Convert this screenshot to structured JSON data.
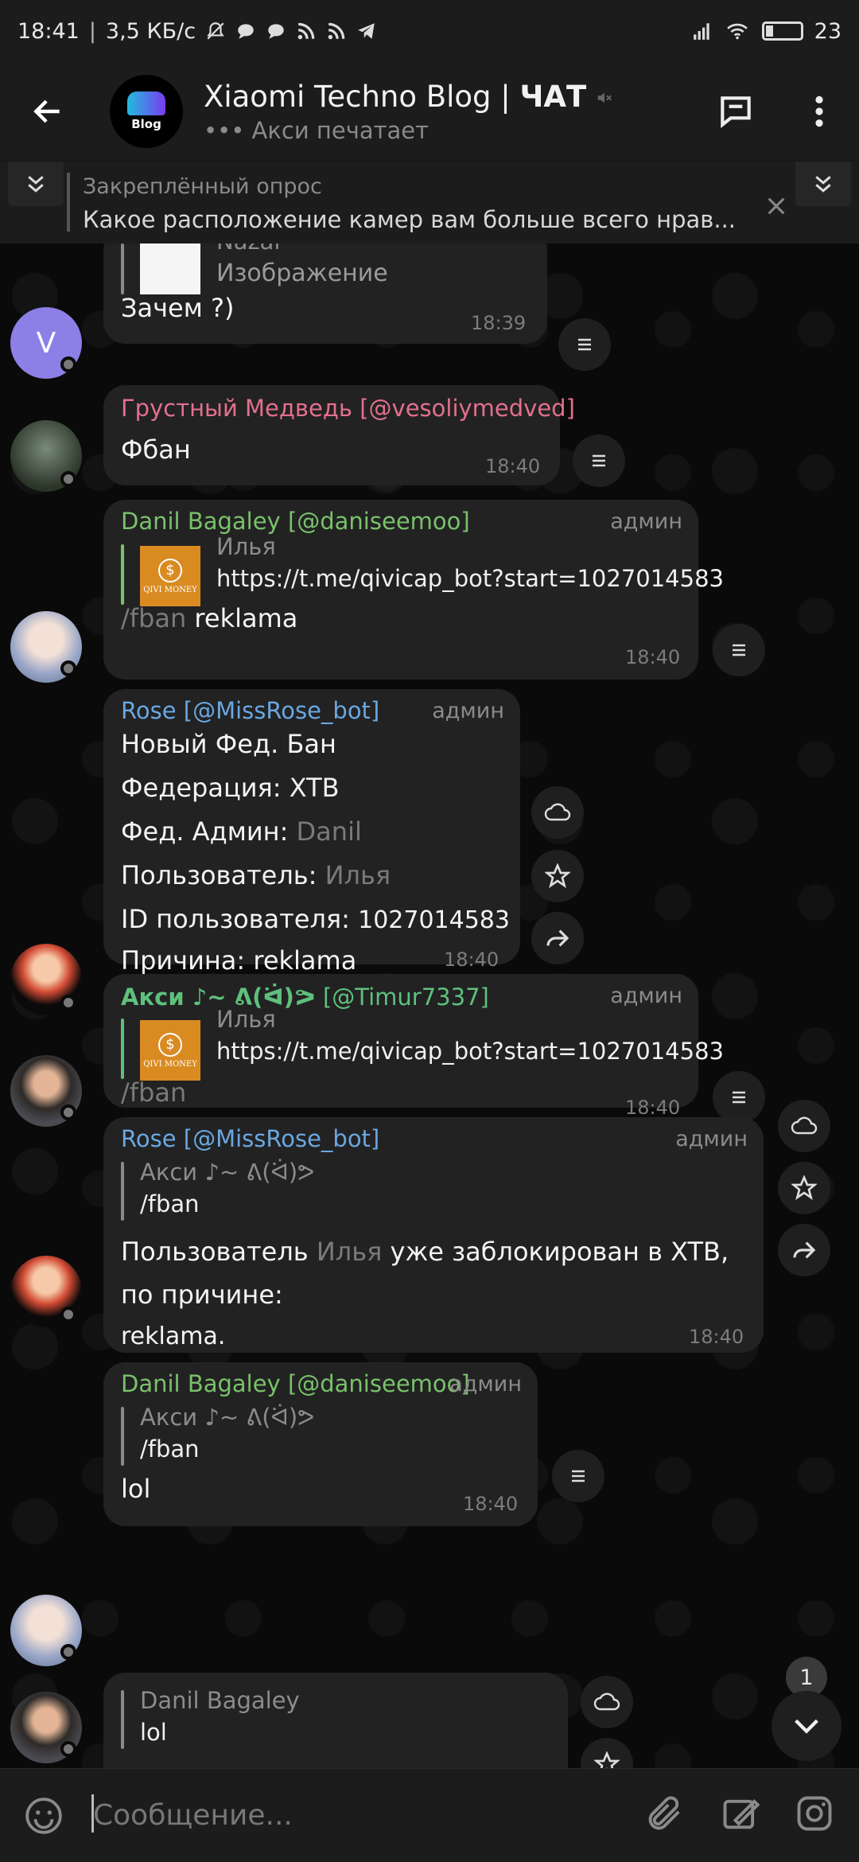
{
  "status_bar": {
    "time": "18:41",
    "speed": "3,5 КБ/с",
    "battery": "23"
  },
  "header": {
    "title": "Xiaomi Techno Blog | ",
    "title_bold": "ЧАТ",
    "subtitle": "••• Акси печатает",
    "avatar_label": "Blog"
  },
  "pinned": {
    "title": "Закреплённый опрос",
    "text": "Какое расположение камер вам больше всего нрав..."
  },
  "messages": [
    {
      "reply_name": "Nazar",
      "reply_text": "Изображение",
      "text": "Зачем ?)",
      "time": "18:39",
      "avatar_letter": "V"
    },
    {
      "name": "Грустный Медведь",
      "handle": "[@vesoliymedved]",
      "text": "Фбан",
      "time": "18:40"
    },
    {
      "name": "Danil Bagaley [@daniseemoo]",
      "admin": "админ",
      "reply_name": "Илья",
      "reply_text": "https://t.me/qivicap_bot?start=1027014583",
      "cmd": "/fban",
      "text": "reklama",
      "time": "18:40",
      "thumb_label": "QIVI MONEY"
    },
    {
      "name": "Rose [@MissRose_bot]",
      "admin": "админ",
      "lines": [
        {
          "key": "Новый Фед. Бан",
          "value": ""
        },
        {
          "key": "Федерация:",
          "value": "XTB"
        },
        {
          "key": "Фед. Админ:",
          "value": "Danil"
        },
        {
          "key": "Пользователь:",
          "value": "Илья"
        },
        {
          "key": "ID пользователя:",
          "value": "1027014583"
        },
        {
          "key": "Причина:",
          "value": "reklama"
        }
      ],
      "time": "18:40"
    },
    {
      "name": "Акси ♪~ ᕕ(ᐛ)ᕗ",
      "handle": "[@Timur7337]",
      "admin": "админ",
      "reply_name": "Илья",
      "reply_text": "https://t.me/qivicap_bot?start=1027014583",
      "cmd": "/fban",
      "time": "18:40",
      "thumb_label": "QIVI MONEY"
    },
    {
      "name": "Rose [@MissRose_bot]",
      "admin": "админ",
      "reply_name": "Акси ♪~ ᕕ(ᐛ)ᕗ",
      "reply_text": "/fban",
      "text_1a": "Пользователь ",
      "text_1b": "Илья",
      "text_1c": " уже заблокирован в XTB,",
      "text_2": "по причине:",
      "text_3": "reklama.",
      "time": "18:40"
    },
    {
      "name": "Danil Bagaley [@daniseemoo]",
      "admin": "админ",
      "reply_name": "Акси ♪~ ᕕ(ᐛ)ᕗ",
      "reply_text": "/fban",
      "text": "lol",
      "time": "18:40"
    },
    {
      "reply_name": "Danil Bagaley",
      "reply_text": "lol"
    }
  ],
  "input": {
    "placeholder": "Сообщение..."
  },
  "fab": {
    "badge": "1"
  },
  "colors": {
    "name_pink": "#e3708e",
    "name_green": "#79c26a",
    "name_blue": "#6aa7e0",
    "name_teal": "#5fc07c"
  }
}
